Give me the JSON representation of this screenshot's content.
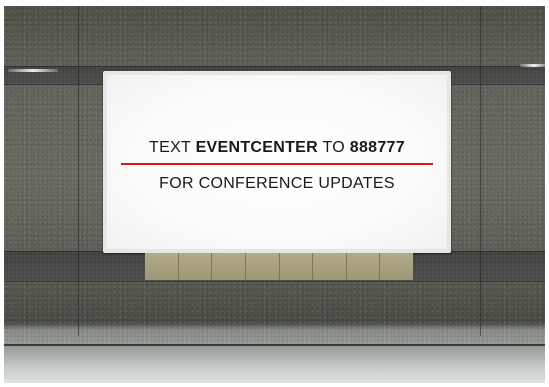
{
  "billboard": {
    "line1_prefix": "TEXT ",
    "line1_keyword": "EVENTCENTER",
    "line1_mid": " TO ",
    "line1_number": "888777",
    "line2": "FOR CONFERENCE UPDATES",
    "divider_color": "#d11a20"
  },
  "scene": {
    "wall_material": "granite",
    "frame_color": "#e6e6e2"
  }
}
